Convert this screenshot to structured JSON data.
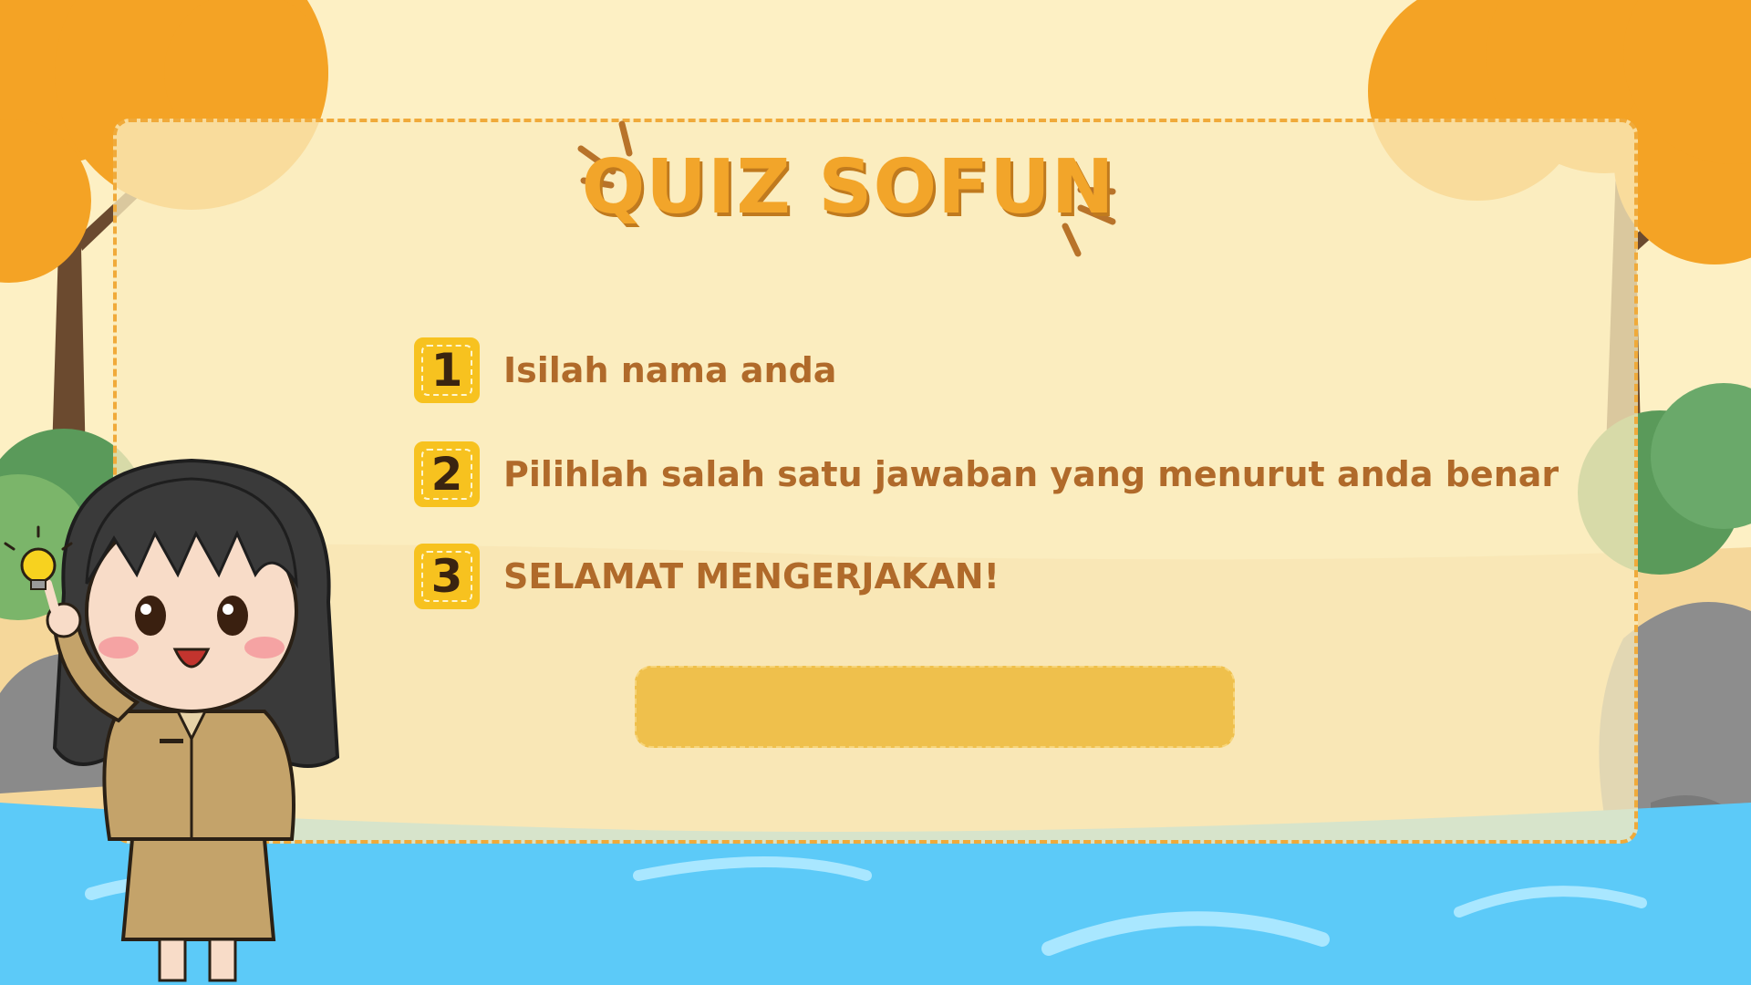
{
  "quiz": {
    "title": "QUIZ SOFUN",
    "rules": [
      {
        "number": "1",
        "text": "Isilah nama anda"
      },
      {
        "number": "2",
        "text": "Pilihlah salah satu jawaban yang menurut anda benar"
      },
      {
        "number": "3",
        "text": "SELAMAT MENGERJAKAN!"
      }
    ],
    "start_button_label": ""
  },
  "colors": {
    "title": "#f2a52a",
    "rule_text": "#b06a2a",
    "badge": "#f7c21f",
    "button": "#efc04c",
    "card_border": "#f0aa3a",
    "water": "#5ccaf8"
  }
}
